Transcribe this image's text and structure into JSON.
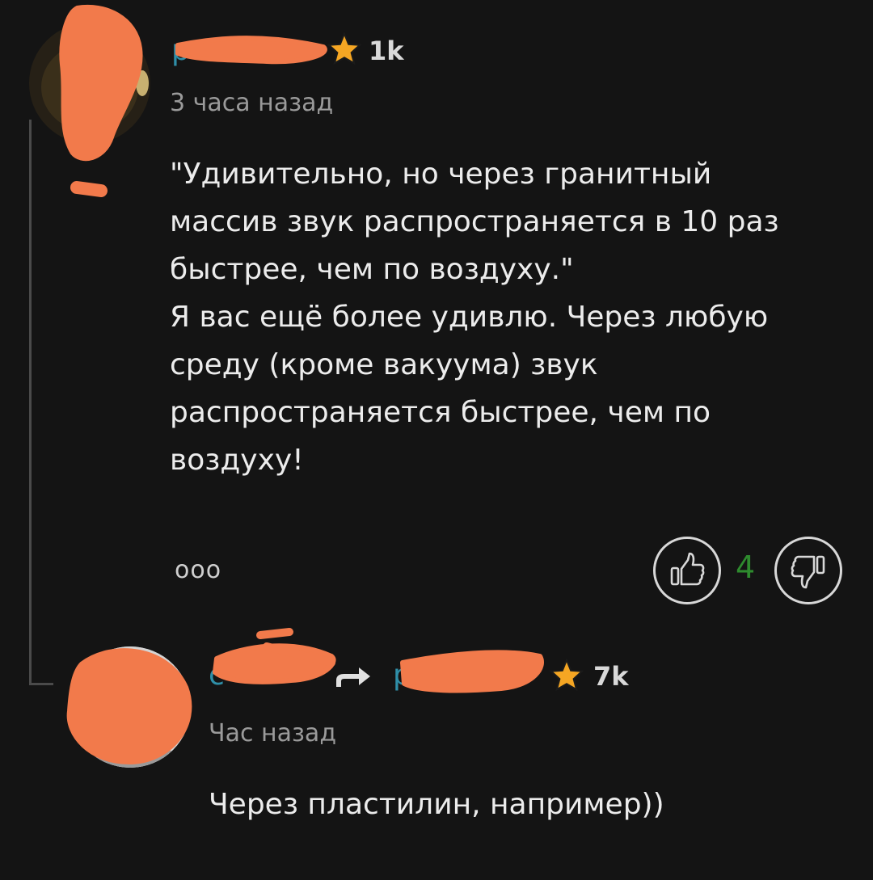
{
  "comment": {
    "author_partial": "p",
    "rating": "1k",
    "timestamp": "3 часа назад",
    "text": "\"Удивительно, но через гранитный массив звук распространяется в 10 раз быстрее, чем по воздуху.\"\nЯ вас ещё более удивлю. Через любую среду (кроме вакуума) звук распространяется быстрее, чем по воздуху!",
    "more_label": "ooo",
    "vote_count": "4"
  },
  "reply": {
    "author_partial": "c",
    "reply_to_partial": "p",
    "rating": "7k",
    "timestamp": "Час назад",
    "text": "Через пластилин, например))"
  },
  "colors": {
    "background": "#141414",
    "username": "#2f8fa8",
    "vote_count": "#2e8b2e",
    "star": "#f5a623",
    "redaction": "#f27a4b"
  }
}
